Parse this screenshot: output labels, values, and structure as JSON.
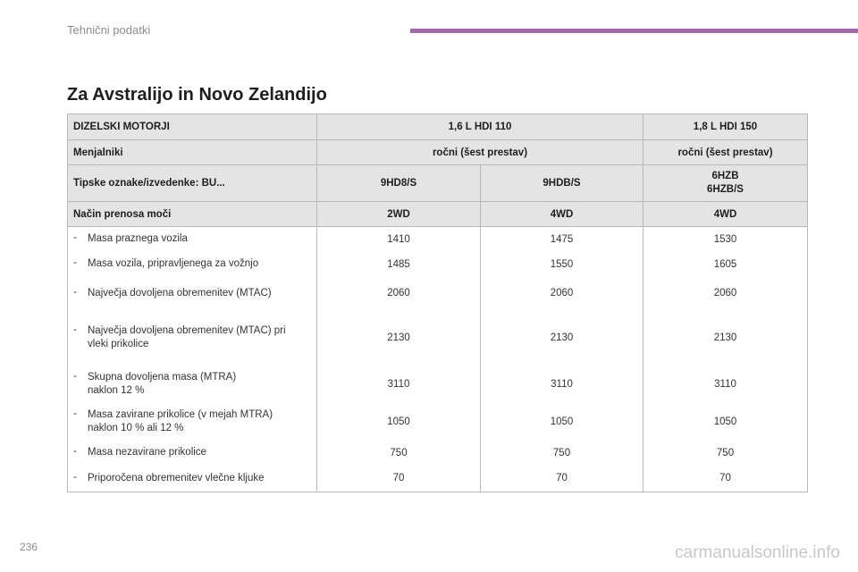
{
  "header": {
    "section_title": "Tehnični podatki"
  },
  "page_title": "Za Avstralijo in Novo Zelandijo",
  "table": {
    "header_rows": [
      {
        "label": "DIZELSKI MOTORJI",
        "engine_a": "1,6 L HDI 110",
        "engine_b": "1,8 L HDI 150"
      },
      {
        "label": "Menjalniki",
        "engine_a": "ročni (šest prestav)",
        "engine_b": "ročni (šest prestav)"
      }
    ],
    "type_row": {
      "label": "Tipske oznake/izvedenke: BU...",
      "col1": "9HD8/S",
      "col2": "9HDB/S",
      "col3_line1": "6HZB",
      "col3_line2": "6HZB/S"
    },
    "drive_row": {
      "label": "Način prenosa moči",
      "col1": "2WD",
      "col2": "4WD",
      "col3": "4WD"
    },
    "rows": [
      {
        "dash": "-",
        "line1": "Masa praznega vozila",
        "line2": "",
        "c1": "1410",
        "c2": "1475",
        "c3": "1530"
      },
      {
        "dash": "-",
        "line1": "Masa vozila, pripravljenega za vožnjo",
        "line2": "",
        "c1": "1485",
        "c2": "1550",
        "c3": "1605"
      },
      {
        "dash": "-",
        "line1": "Največja dovoljena obremenitev (MTAC)",
        "line2": "",
        "c1": "2060",
        "c2": "2060",
        "c3": "2060"
      },
      {
        "dash": "-",
        "line1": "Največja dovoljena obremenitev (MTAC) pri",
        "line2": "vleki prikolice",
        "c1": "2130",
        "c2": "2130",
        "c3": "2130"
      },
      {
        "dash": "-",
        "line1": "Skupna dovoljena masa (MTRA)",
        "line2": "naklon 12 %",
        "c1": "3110",
        "c2": "3110",
        "c3": "3110"
      },
      {
        "dash": "-",
        "line1": "Masa zavirane prikolice (v mejah MTRA)",
        "line2": "naklon 10 % ali 12 %",
        "c1": "1050",
        "c2": "1050",
        "c3": "1050"
      },
      {
        "dash": "-",
        "line1": "Masa nezavirane prikolice",
        "line2": "",
        "c1": "750",
        "c2": "750",
        "c3": "750"
      },
      {
        "dash": "-",
        "line1": "Priporočena obremenitev vlečne kljuke",
        "line2": "",
        "c1": "70",
        "c2": "70",
        "c3": "70"
      }
    ]
  },
  "footer": {
    "page_number": "236",
    "watermark": "carmanualsonline.info"
  },
  "colors": {
    "accent_bar": "#a46aa9",
    "header_fill": "#e4e4e4",
    "grid_line": "#b8b8b8"
  }
}
